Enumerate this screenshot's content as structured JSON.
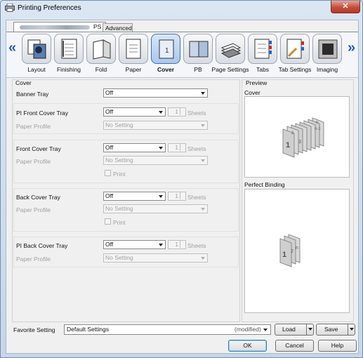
{
  "window": {
    "title": "Printing Preferences",
    "close_glyph": "✕"
  },
  "tabs": [
    {
      "label": "PS",
      "selected": true
    },
    {
      "label": "Advanced",
      "selected": false
    }
  ],
  "ribbon": {
    "items": [
      {
        "label": "Layout",
        "icon": "layout-icon"
      },
      {
        "label": "Finishing",
        "icon": "finishing-icon"
      },
      {
        "label": "Fold",
        "icon": "fold-icon"
      },
      {
        "label": "Paper",
        "icon": "paper-icon"
      },
      {
        "label": "Cover",
        "icon": "cover-icon",
        "selected": true
      },
      {
        "label": "PB",
        "icon": "pb-icon"
      },
      {
        "label": "Page Settings",
        "icon": "page-settings-icon"
      },
      {
        "label": "Tabs",
        "icon": "tabs-icon"
      },
      {
        "label": "Tab Settings",
        "icon": "tab-settings-icon"
      },
      {
        "label": "Imaging",
        "icon": "imaging-icon"
      }
    ],
    "left_arrow": "«",
    "right_arrow": "»"
  },
  "cover": {
    "section_title": "Cover",
    "banner_tray": {
      "label": "Banner Tray",
      "value": "Off"
    },
    "pi_front": {
      "label": "PI Front Cover Tray",
      "value": "Off",
      "sheets": "1",
      "sheets_label": "Sheets",
      "profile_label": "Paper Profile",
      "profile_value": "No Setting"
    },
    "front": {
      "label": "Front Cover Tray",
      "value": "Off",
      "sheets": "1",
      "sheets_label": "Sheets",
      "profile_label": "Paper Profile",
      "profile_value": "No Setting",
      "print_label": "Print"
    },
    "back": {
      "label": "Back Cover Tray",
      "value": "Off",
      "sheets": "1",
      "sheets_label": "Sheets",
      "profile_label": "Paper Profile",
      "profile_value": "No Setting",
      "print_label": "Print"
    },
    "pi_back": {
      "label": "PI Back Cover Tray",
      "value": "Off",
      "sheets": "1",
      "sheets_label": "Sheets",
      "profile_label": "Paper Profile",
      "profile_value": "No Setting"
    }
  },
  "preview": {
    "section_title": "Preview",
    "cover_title": "Cover",
    "cover_pages": [
      "1",
      "2",
      "3",
      "n-1",
      "n"
    ],
    "binding_title": "Perfect Binding",
    "binding_pages": [
      "1",
      "2",
      "n"
    ]
  },
  "favorite": {
    "label": "Favorite Setting",
    "value": "Default Settings",
    "modified": "(modified)",
    "load_label": "Load",
    "save_label": "Save"
  },
  "dialog_buttons": {
    "ok": "OK",
    "cancel": "Cancel",
    "help": "Help"
  }
}
